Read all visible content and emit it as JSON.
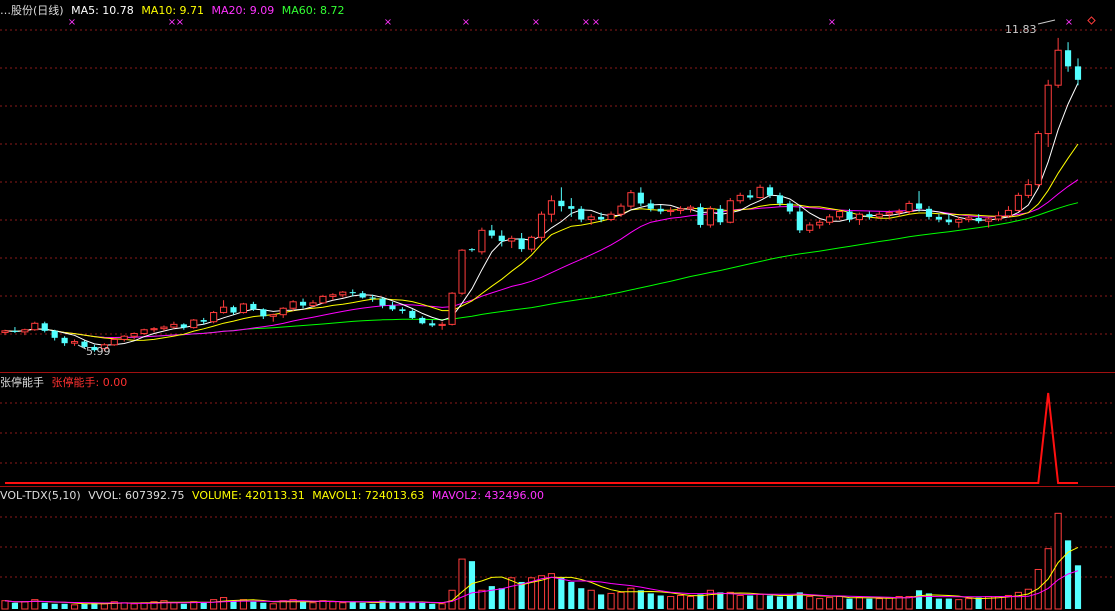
{
  "main": {
    "title": "…股份(日线)",
    "ma5": "MA5: 10.78",
    "ma10": "MA10: 9.71",
    "ma20": "MA20: 9.09",
    "ma60": "MA60: 8.72",
    "high_label": "11.83",
    "low_label": "5.99"
  },
  "indicator": {
    "name": "张停能手",
    "value_label": "张停能手: 0.00"
  },
  "volume": {
    "name": "VOL-TDX(5,10)",
    "vvol": "VVOL: 607392.75",
    "volume": "VOLUME: 420113.31",
    "mavol1": "MAVOL1: 724013.63",
    "mavol2": "MAVOL2: 432496.00"
  },
  "colors": {
    "up": "#ff3c3c",
    "down": "#54ffff",
    "ma5": "#ffffff",
    "ma10": "#ffff00",
    "ma20": "#ff00ff",
    "ma60": "#00ff00",
    "grid": "#8a1a1a"
  },
  "chart_data": {
    "type": "candlestick",
    "candles": [
      [
        6.35,
        6.4,
        6.3,
        6.38
      ],
      [
        6.38,
        6.45,
        6.34,
        6.36
      ],
      [
        6.36,
        6.42,
        6.3,
        6.4
      ],
      [
        6.4,
        6.55,
        6.38,
        6.52
      ],
      [
        6.52,
        6.55,
        6.35,
        6.38
      ],
      [
        6.38,
        6.4,
        6.2,
        6.25
      ],
      [
        6.25,
        6.28,
        6.1,
        6.15
      ],
      [
        6.15,
        6.22,
        6.1,
        6.18
      ],
      [
        6.18,
        6.2,
        6.05,
        6.08
      ],
      [
        6.08,
        6.12,
        5.99,
        6.02
      ],
      [
        6.05,
        6.15,
        6.0,
        6.12
      ],
      [
        6.12,
        6.25,
        6.1,
        6.22
      ],
      [
        6.22,
        6.3,
        6.18,
        6.28
      ],
      [
        6.28,
        6.35,
        6.22,
        6.33
      ],
      [
        6.33,
        6.42,
        6.3,
        6.4
      ],
      [
        6.4,
        6.45,
        6.35,
        6.42
      ],
      [
        6.42,
        6.48,
        6.38,
        6.45
      ],
      [
        6.45,
        6.55,
        6.42,
        6.5
      ],
      [
        6.5,
        6.52,
        6.4,
        6.44
      ],
      [
        6.44,
        6.6,
        6.42,
        6.58
      ],
      [
        6.58,
        6.62,
        6.5,
        6.55
      ],
      [
        6.55,
        6.75,
        6.52,
        6.72
      ],
      [
        6.72,
        6.95,
        6.7,
        6.82
      ],
      [
        6.82,
        6.85,
        6.68,
        6.72
      ],
      [
        6.72,
        6.9,
        6.7,
        6.88
      ],
      [
        6.88,
        6.92,
        6.75,
        6.78
      ],
      [
        6.78,
        6.8,
        6.6,
        6.65
      ],
      [
        6.65,
        6.7,
        6.55,
        6.68
      ],
      [
        6.68,
        6.82,
        6.62,
        6.8
      ],
      [
        6.8,
        6.95,
        6.75,
        6.92
      ],
      [
        6.92,
        6.98,
        6.8,
        6.85
      ],
      [
        6.85,
        6.95,
        6.82,
        6.9
      ],
      [
        6.9,
        7.05,
        6.88,
        7.02
      ],
      [
        7.02,
        7.08,
        6.95,
        7.05
      ],
      [
        7.05,
        7.12,
        7.0,
        7.1
      ],
      [
        7.1,
        7.15,
        7.02,
        7.08
      ],
      [
        7.08,
        7.12,
        6.98,
        7.0
      ],
      [
        7.0,
        7.05,
        6.92,
        6.98
      ],
      [
        6.98,
        7.0,
        6.8,
        6.85
      ],
      [
        6.85,
        6.92,
        6.75,
        6.78
      ],
      [
        6.78,
        6.82,
        6.7,
        6.75
      ],
      [
        6.75,
        6.78,
        6.6,
        6.62
      ],
      [
        6.62,
        6.65,
        6.5,
        6.52
      ],
      [
        6.52,
        6.58,
        6.45,
        6.48
      ],
      [
        6.48,
        6.55,
        6.4,
        6.5
      ],
      [
        6.5,
        7.1,
        6.48,
        7.08
      ],
      [
        7.08,
        7.9,
        7.05,
        7.88
      ],
      [
        7.9,
        7.92,
        7.85,
        7.88
      ],
      [
        7.85,
        8.3,
        7.8,
        8.25
      ],
      [
        8.25,
        8.35,
        8.1,
        8.15
      ],
      [
        8.15,
        8.25,
        7.95,
        8.05
      ],
      [
        8.05,
        8.15,
        7.92,
        8.1
      ],
      [
        8.1,
        8.2,
        7.85,
        7.9
      ],
      [
        7.9,
        8.15,
        7.85,
        8.12
      ],
      [
        8.12,
        8.6,
        8.05,
        8.55
      ],
      [
        8.55,
        8.9,
        8.4,
        8.8
      ],
      [
        8.8,
        9.05,
        8.6,
        8.7
      ],
      [
        8.7,
        8.85,
        8.5,
        8.65
      ],
      [
        8.65,
        8.7,
        8.4,
        8.45
      ],
      [
        8.45,
        8.55,
        8.35,
        8.5
      ],
      [
        8.5,
        8.58,
        8.4,
        8.45
      ],
      [
        8.45,
        8.6,
        8.42,
        8.55
      ],
      [
        8.55,
        8.75,
        8.5,
        8.7
      ],
      [
        8.7,
        9.0,
        8.65,
        8.95
      ],
      [
        8.95,
        9.05,
        8.7,
        8.75
      ],
      [
        8.75,
        8.82,
        8.6,
        8.65
      ],
      [
        8.65,
        8.72,
        8.55,
        8.6
      ],
      [
        8.6,
        8.68,
        8.52,
        8.62
      ],
      [
        8.62,
        8.7,
        8.55,
        8.65
      ],
      [
        8.65,
        8.72,
        8.58,
        8.68
      ],
      [
        8.68,
        8.75,
        8.3,
        8.35
      ],
      [
        8.35,
        8.7,
        8.3,
        8.65
      ],
      [
        8.65,
        8.72,
        8.35,
        8.4
      ],
      [
        8.4,
        8.85,
        8.38,
        8.8
      ],
      [
        8.8,
        8.95,
        8.75,
        8.9
      ],
      [
        8.9,
        9.0,
        8.82,
        8.86
      ],
      [
        8.86,
        9.1,
        8.84,
        9.05
      ],
      [
        9.05,
        9.1,
        8.85,
        8.9
      ],
      [
        8.9,
        8.95,
        8.7,
        8.75
      ],
      [
        8.75,
        8.8,
        8.55,
        8.6
      ],
      [
        8.6,
        8.7,
        8.2,
        8.25
      ],
      [
        8.25,
        8.4,
        8.2,
        8.35
      ],
      [
        8.35,
        8.45,
        8.28,
        8.4
      ],
      [
        8.4,
        8.55,
        8.35,
        8.5
      ],
      [
        8.5,
        8.62,
        8.45,
        8.6
      ],
      [
        8.6,
        8.65,
        8.4,
        8.45
      ],
      [
        8.45,
        8.58,
        8.35,
        8.55
      ],
      [
        8.55,
        8.6,
        8.45,
        8.5
      ],
      [
        8.5,
        8.6,
        8.46,
        8.55
      ],
      [
        8.55,
        8.62,
        8.45,
        8.58
      ],
      [
        8.58,
        8.65,
        8.5,
        8.6
      ],
      [
        8.6,
        8.8,
        8.55,
        8.75
      ],
      [
        8.75,
        8.98,
        8.6,
        8.65
      ],
      [
        8.65,
        8.7,
        8.45,
        8.5
      ],
      [
        8.5,
        8.55,
        8.4,
        8.45
      ],
      [
        8.45,
        8.55,
        8.35,
        8.4
      ],
      [
        8.4,
        8.5,
        8.3,
        8.45
      ],
      [
        8.45,
        8.52,
        8.4,
        8.48
      ],
      [
        8.48,
        8.55,
        8.38,
        8.42
      ],
      [
        8.42,
        8.5,
        8.3,
        8.46
      ],
      [
        8.46,
        8.6,
        8.42,
        8.52
      ],
      [
        8.52,
        8.7,
        8.48,
        8.62
      ],
      [
        8.62,
        8.95,
        8.6,
        8.9
      ],
      [
        8.9,
        9.2,
        8.85,
        9.1
      ],
      [
        9.1,
        10.1,
        9.05,
        10.05
      ],
      [
        10.05,
        11.05,
        9.8,
        10.95
      ],
      [
        10.95,
        11.83,
        10.9,
        11.6
      ],
      [
        11.6,
        11.75,
        11.2,
        11.3
      ],
      [
        11.3,
        11.45,
        10.95,
        11.05
      ]
    ],
    "ma5_last": 10.78,
    "ma10_last": 9.71,
    "ma20_last": 9.09,
    "ma60_last": 8.72,
    "volumes": [
      0.08,
      0.06,
      0.07,
      0.09,
      0.06,
      0.05,
      0.05,
      0.04,
      0.05,
      0.06,
      0.05,
      0.07,
      0.06,
      0.05,
      0.06,
      0.07,
      0.08,
      0.06,
      0.05,
      0.07,
      0.06,
      0.09,
      0.11,
      0.08,
      0.09,
      0.07,
      0.06,
      0.05,
      0.08,
      0.09,
      0.07,
      0.06,
      0.08,
      0.07,
      0.06,
      0.07,
      0.06,
      0.05,
      0.08,
      0.07,
      0.06,
      0.07,
      0.06,
      0.05,
      0.05,
      0.18,
      0.48,
      0.46,
      0.18,
      0.22,
      0.2,
      0.3,
      0.26,
      0.3,
      0.32,
      0.34,
      0.3,
      0.26,
      0.2,
      0.18,
      0.14,
      0.15,
      0.16,
      0.2,
      0.18,
      0.15,
      0.13,
      0.12,
      0.13,
      0.12,
      0.14,
      0.18,
      0.16,
      0.16,
      0.13,
      0.13,
      0.14,
      0.13,
      0.12,
      0.13,
      0.16,
      0.12,
      0.1,
      0.11,
      0.12,
      0.1,
      0.11,
      0.1,
      0.1,
      0.11,
      0.12,
      0.12,
      0.18,
      0.15,
      0.1,
      0.1,
      0.09,
      0.1,
      0.11,
      0.12,
      0.12,
      0.13,
      0.16,
      0.19,
      0.38,
      0.58,
      0.92,
      0.66,
      0.42
    ],
    "indicator_values": [
      0,
      0,
      0,
      0,
      0,
      0,
      0,
      0,
      0,
      0,
      0,
      0,
      0,
      0,
      0,
      0,
      0,
      0,
      0,
      0,
      0,
      0,
      0,
      0,
      0,
      0,
      0,
      0,
      0,
      0,
      0,
      0,
      0,
      0,
      0,
      0,
      0,
      0,
      0,
      0,
      0,
      0,
      0,
      0,
      0,
      0,
      0,
      0,
      0,
      0,
      0,
      0,
      0,
      0,
      0,
      0,
      0,
      0,
      0,
      0,
      0,
      0,
      0,
      0,
      0,
      0,
      0,
      0,
      0,
      0,
      0,
      0,
      0,
      0,
      0,
      0,
      0,
      0,
      0,
      0,
      0,
      0,
      0,
      0,
      0,
      0,
      0,
      0,
      0,
      0,
      0,
      0,
      0,
      0,
      0,
      0,
      0,
      0,
      0,
      0,
      0,
      0,
      0,
      0,
      0,
      1,
      0,
      0,
      0
    ],
    "ylim": [
      5.8,
      12.2
    ]
  }
}
